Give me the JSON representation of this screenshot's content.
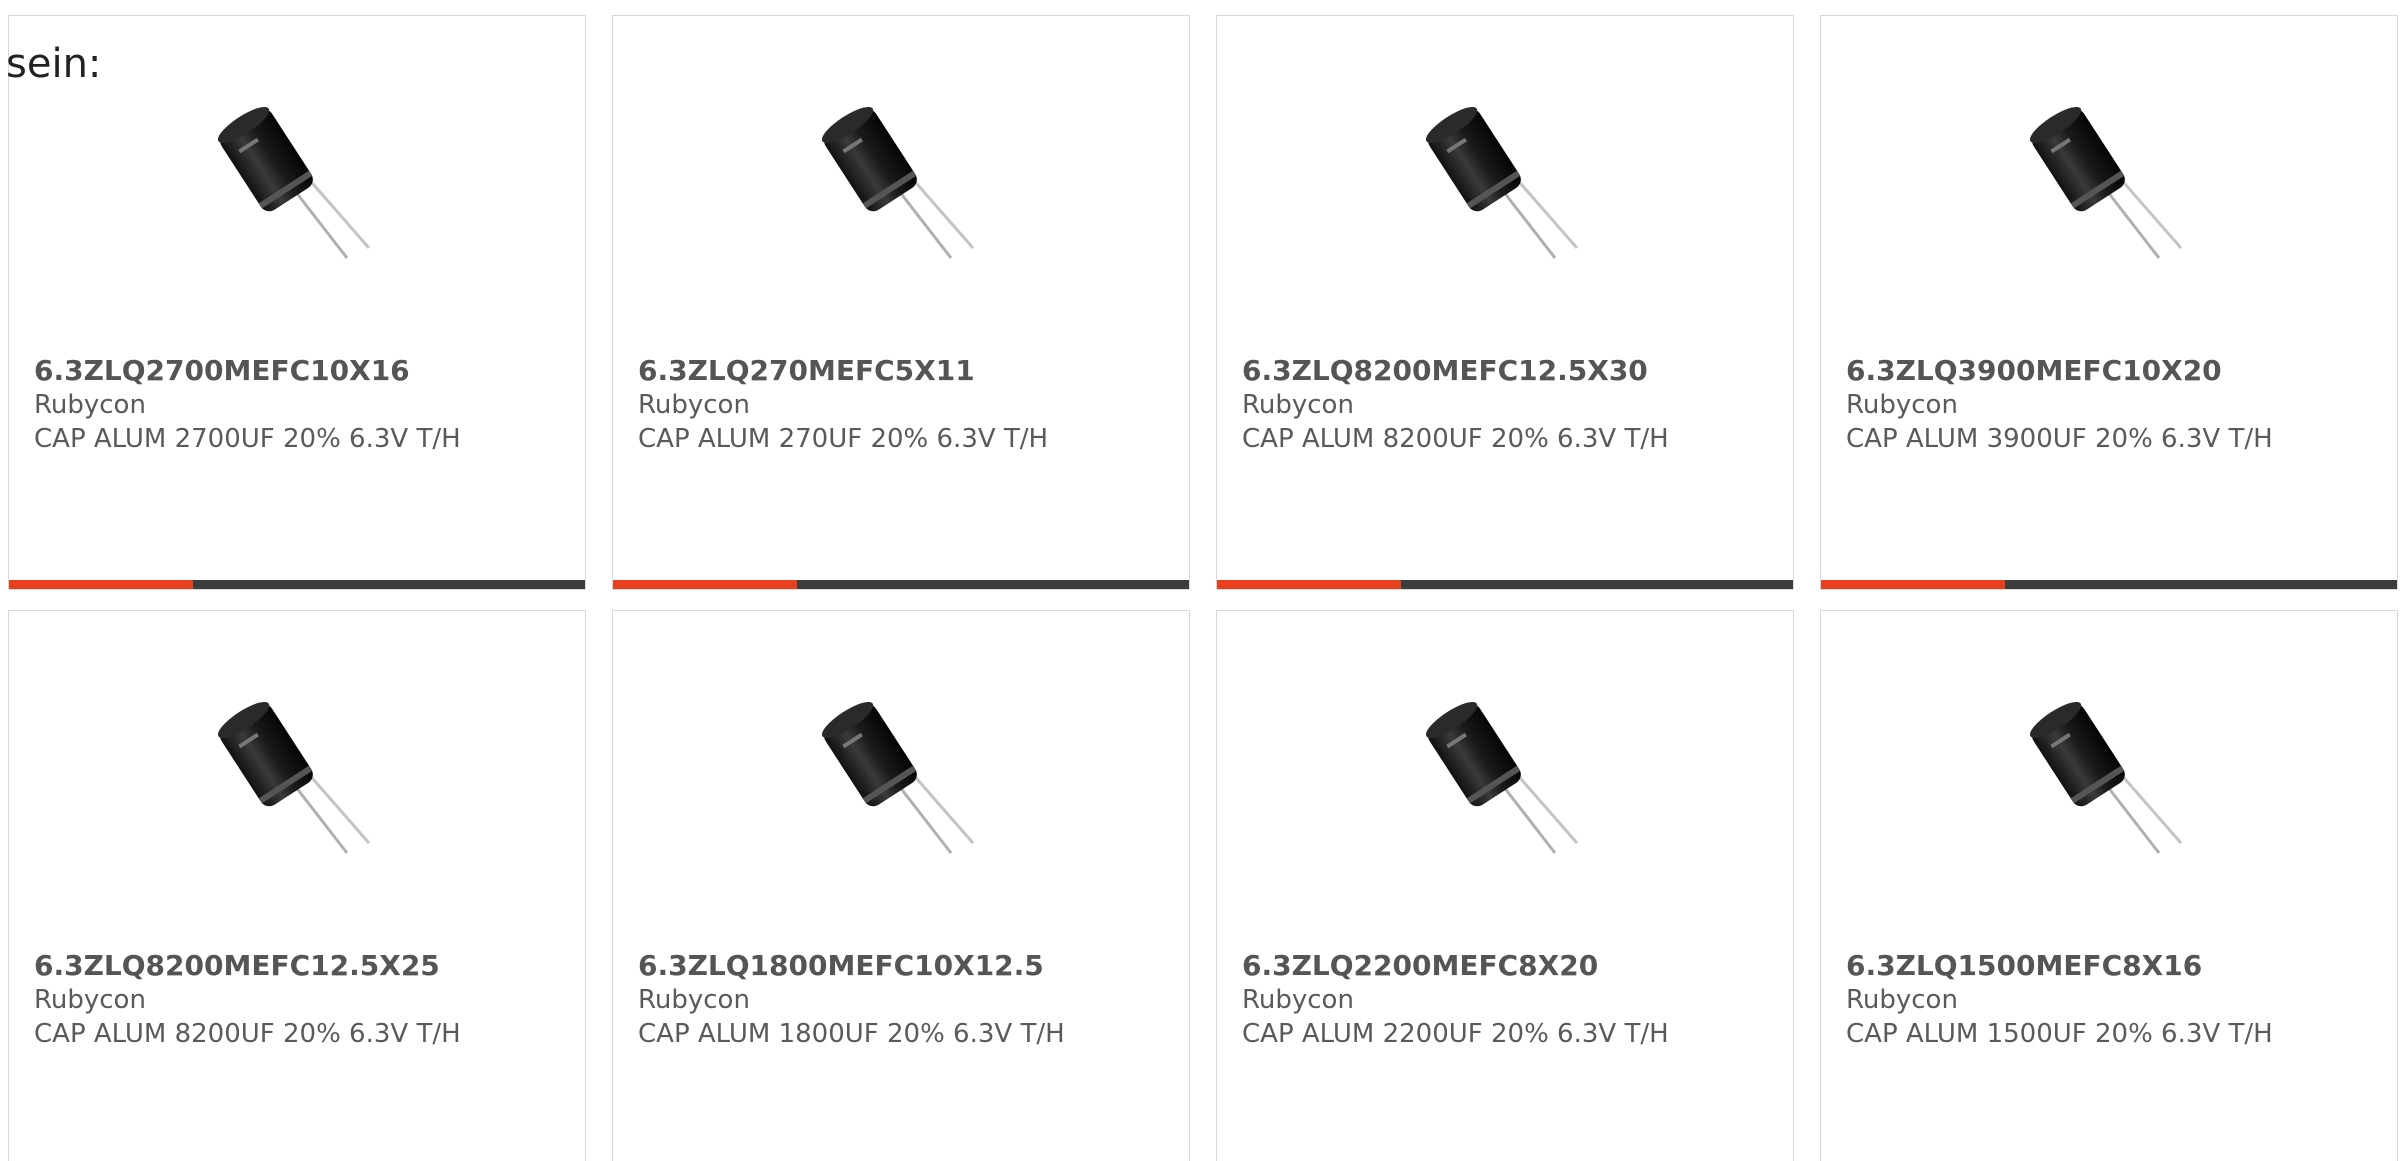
{
  "intro_text": "sein:",
  "accent_color": "#e8401c",
  "track_color": "#3d3d3d",
  "products": [
    {
      "part_number": "6.3ZLQ2700MEFC10X16",
      "manufacturer": "Rubycon",
      "description": "CAP ALUM 2700UF 20% 6.3V T/H",
      "image_icon": "capacitor-icon",
      "progress": 0.32
    },
    {
      "part_number": "6.3ZLQ270MEFC5X11",
      "manufacturer": "Rubycon",
      "description": "CAP ALUM 270UF 20% 6.3V T/H",
      "image_icon": "capacitor-icon",
      "progress": 0.32
    },
    {
      "part_number": "6.3ZLQ8200MEFC12.5X30",
      "manufacturer": "Rubycon",
      "description": "CAP ALUM 8200UF 20% 6.3V T/H",
      "image_icon": "capacitor-icon",
      "progress": 0.32
    },
    {
      "part_number": "6.3ZLQ3900MEFC10X20",
      "manufacturer": "Rubycon",
      "description": "CAP ALUM 3900UF 20% 6.3V T/H",
      "image_icon": "capacitor-icon",
      "progress": 0.32
    },
    {
      "part_number": "6.3ZLQ8200MEFC12.5X25",
      "manufacturer": "Rubycon",
      "description": "CAP ALUM 8200UF 20% 6.3V T/H",
      "image_icon": "capacitor-icon"
    },
    {
      "part_number": "6.3ZLQ1800MEFC10X12.5",
      "manufacturer": "Rubycon",
      "description": "CAP ALUM 1800UF 20% 6.3V T/H",
      "image_icon": "capacitor-icon"
    },
    {
      "part_number": "6.3ZLQ2200MEFC8X20",
      "manufacturer": "Rubycon",
      "description": "CAP ALUM 2200UF 20% 6.3V T/H",
      "image_icon": "capacitor-icon"
    },
    {
      "part_number": "6.3ZLQ1500MEFC8X16",
      "manufacturer": "Rubycon",
      "description": "CAP ALUM 1500UF 20% 6.3V T/H",
      "image_icon": "capacitor-icon"
    }
  ]
}
